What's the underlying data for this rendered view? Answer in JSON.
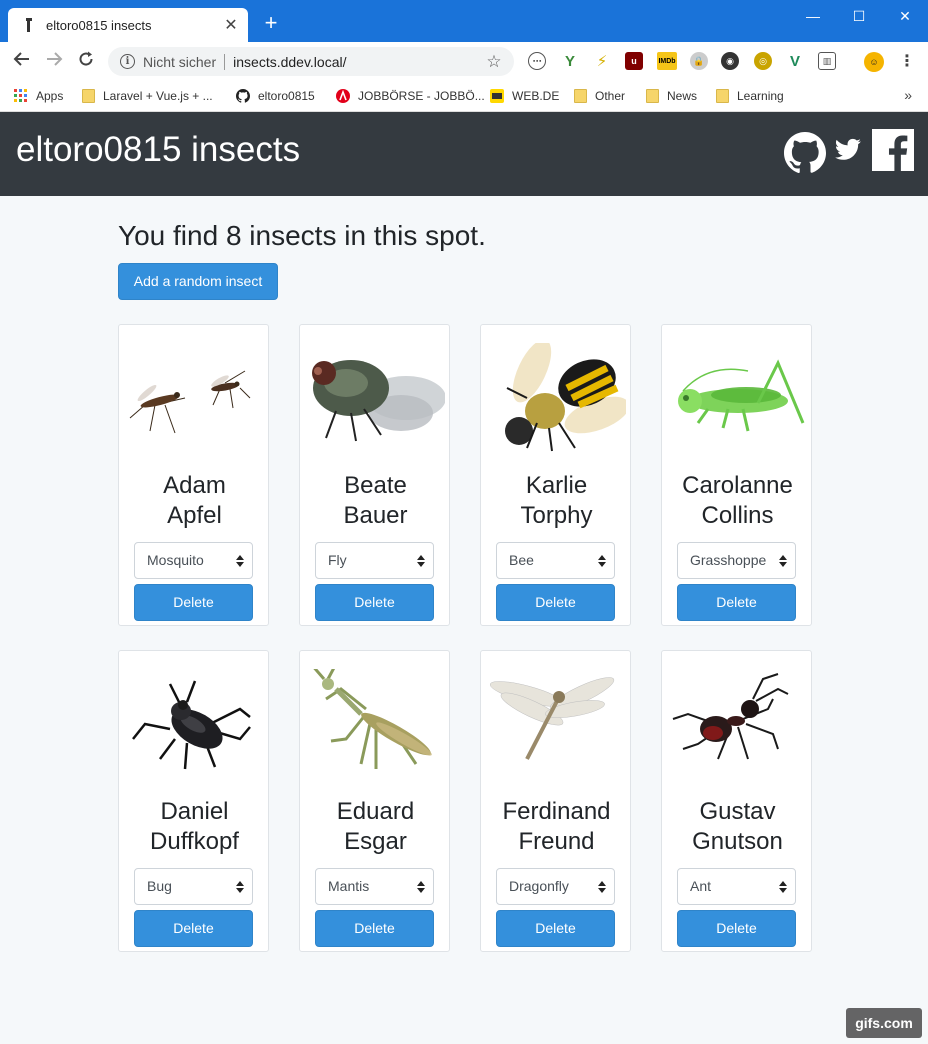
{
  "browser": {
    "tab_title": "eltoro0815 insects",
    "new_tab": "+",
    "omnibox": {
      "security_label": "Nicht sicher",
      "url": "insects.ddev.local/"
    },
    "bookmarks": [
      {
        "label": "Apps",
        "icon": "apps-grid-icon"
      },
      {
        "label": "Laravel + Vue.js + ...",
        "icon": "folder-icon"
      },
      {
        "label": "eltoro0815",
        "icon": "github-icon"
      },
      {
        "label": "JOBBÖRSE - JOBBÖ...",
        "icon": "arbeitsagentur-icon"
      },
      {
        "label": "WEB.DE",
        "icon": "webde-icon"
      },
      {
        "label": "Other",
        "icon": "folder-icon"
      },
      {
        "label": "News",
        "icon": "folder-icon"
      },
      {
        "label": "Learning",
        "icon": "folder-icon"
      }
    ],
    "accent_color": "#1a73d9"
  },
  "page": {
    "brand": "eltoro0815 insects",
    "heading": "You find 8 insects in this spot.",
    "add_button": "Add a random insect",
    "delete_label": "Delete",
    "primary_color": "#3490dc",
    "header_color": "#343a40"
  },
  "cards": [
    {
      "first": "Adam",
      "last": "Apfel",
      "insect": "Mosquito",
      "image": "mosquito"
    },
    {
      "first": "Beate",
      "last": "Bauer",
      "insect": "Fly",
      "image": "fly"
    },
    {
      "first": "Karlie",
      "last": "Torphy",
      "insect": "Bee",
      "image": "bee"
    },
    {
      "first": "Carolanne",
      "last": "Collins",
      "insect": "Grasshoppe",
      "image": "grasshopper"
    },
    {
      "first": "Daniel",
      "last": "Duffkopf",
      "insect": "Bug",
      "image": "beetle"
    },
    {
      "first": "Eduard",
      "last": "Esgar",
      "insect": "Mantis",
      "image": "mantis"
    },
    {
      "first": "Ferdinand",
      "last": "Freund",
      "insect": "Dragonfly",
      "image": "dragonfly"
    },
    {
      "first": "Gustav",
      "last": "Gnutson",
      "insect": "Ant",
      "image": "ant"
    }
  ],
  "watermark": "gifs.com"
}
